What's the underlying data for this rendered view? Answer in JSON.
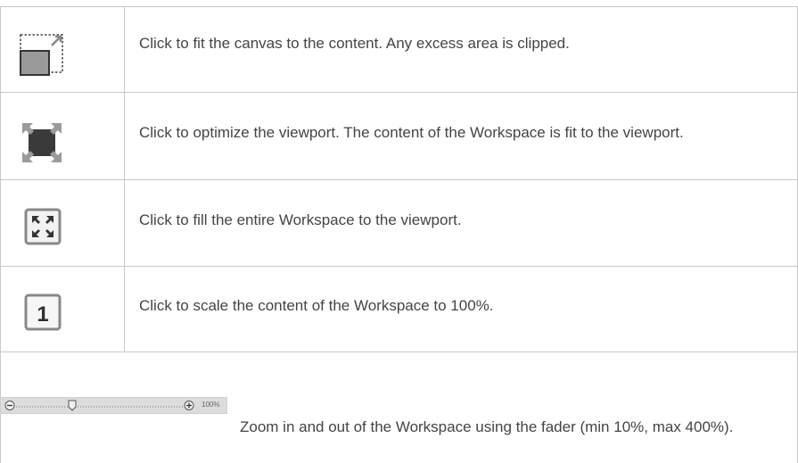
{
  "rows": [
    {
      "icon": "fit-canvas-icon",
      "description": "Click to fit the canvas to the content. Any excess area is clipped."
    },
    {
      "icon": "optimize-viewport-icon",
      "description": "Click to optimize the viewport. The content of the Workspace is fit to the viewport."
    },
    {
      "icon": "fill-workspace-icon",
      "description": "Click to fill the entire Workspace to the viewport."
    },
    {
      "icon": "scale-100-icon",
      "description": "Click to scale the content of the Workspace to 100%.",
      "icon_label": "1"
    }
  ],
  "zoom": {
    "icon": "zoom-fader-icon",
    "percent_label": "100%",
    "fader_value_percent": 100,
    "description": "Zoom in and out of the Workspace using the fader (min 10%, max 400%)."
  },
  "colors": {
    "text": "#444444",
    "border": "#c9c9c9",
    "icon_gray": "#888888",
    "icon_dark": "#3a3a3a",
    "fader_bg": "#dcdcdc"
  }
}
